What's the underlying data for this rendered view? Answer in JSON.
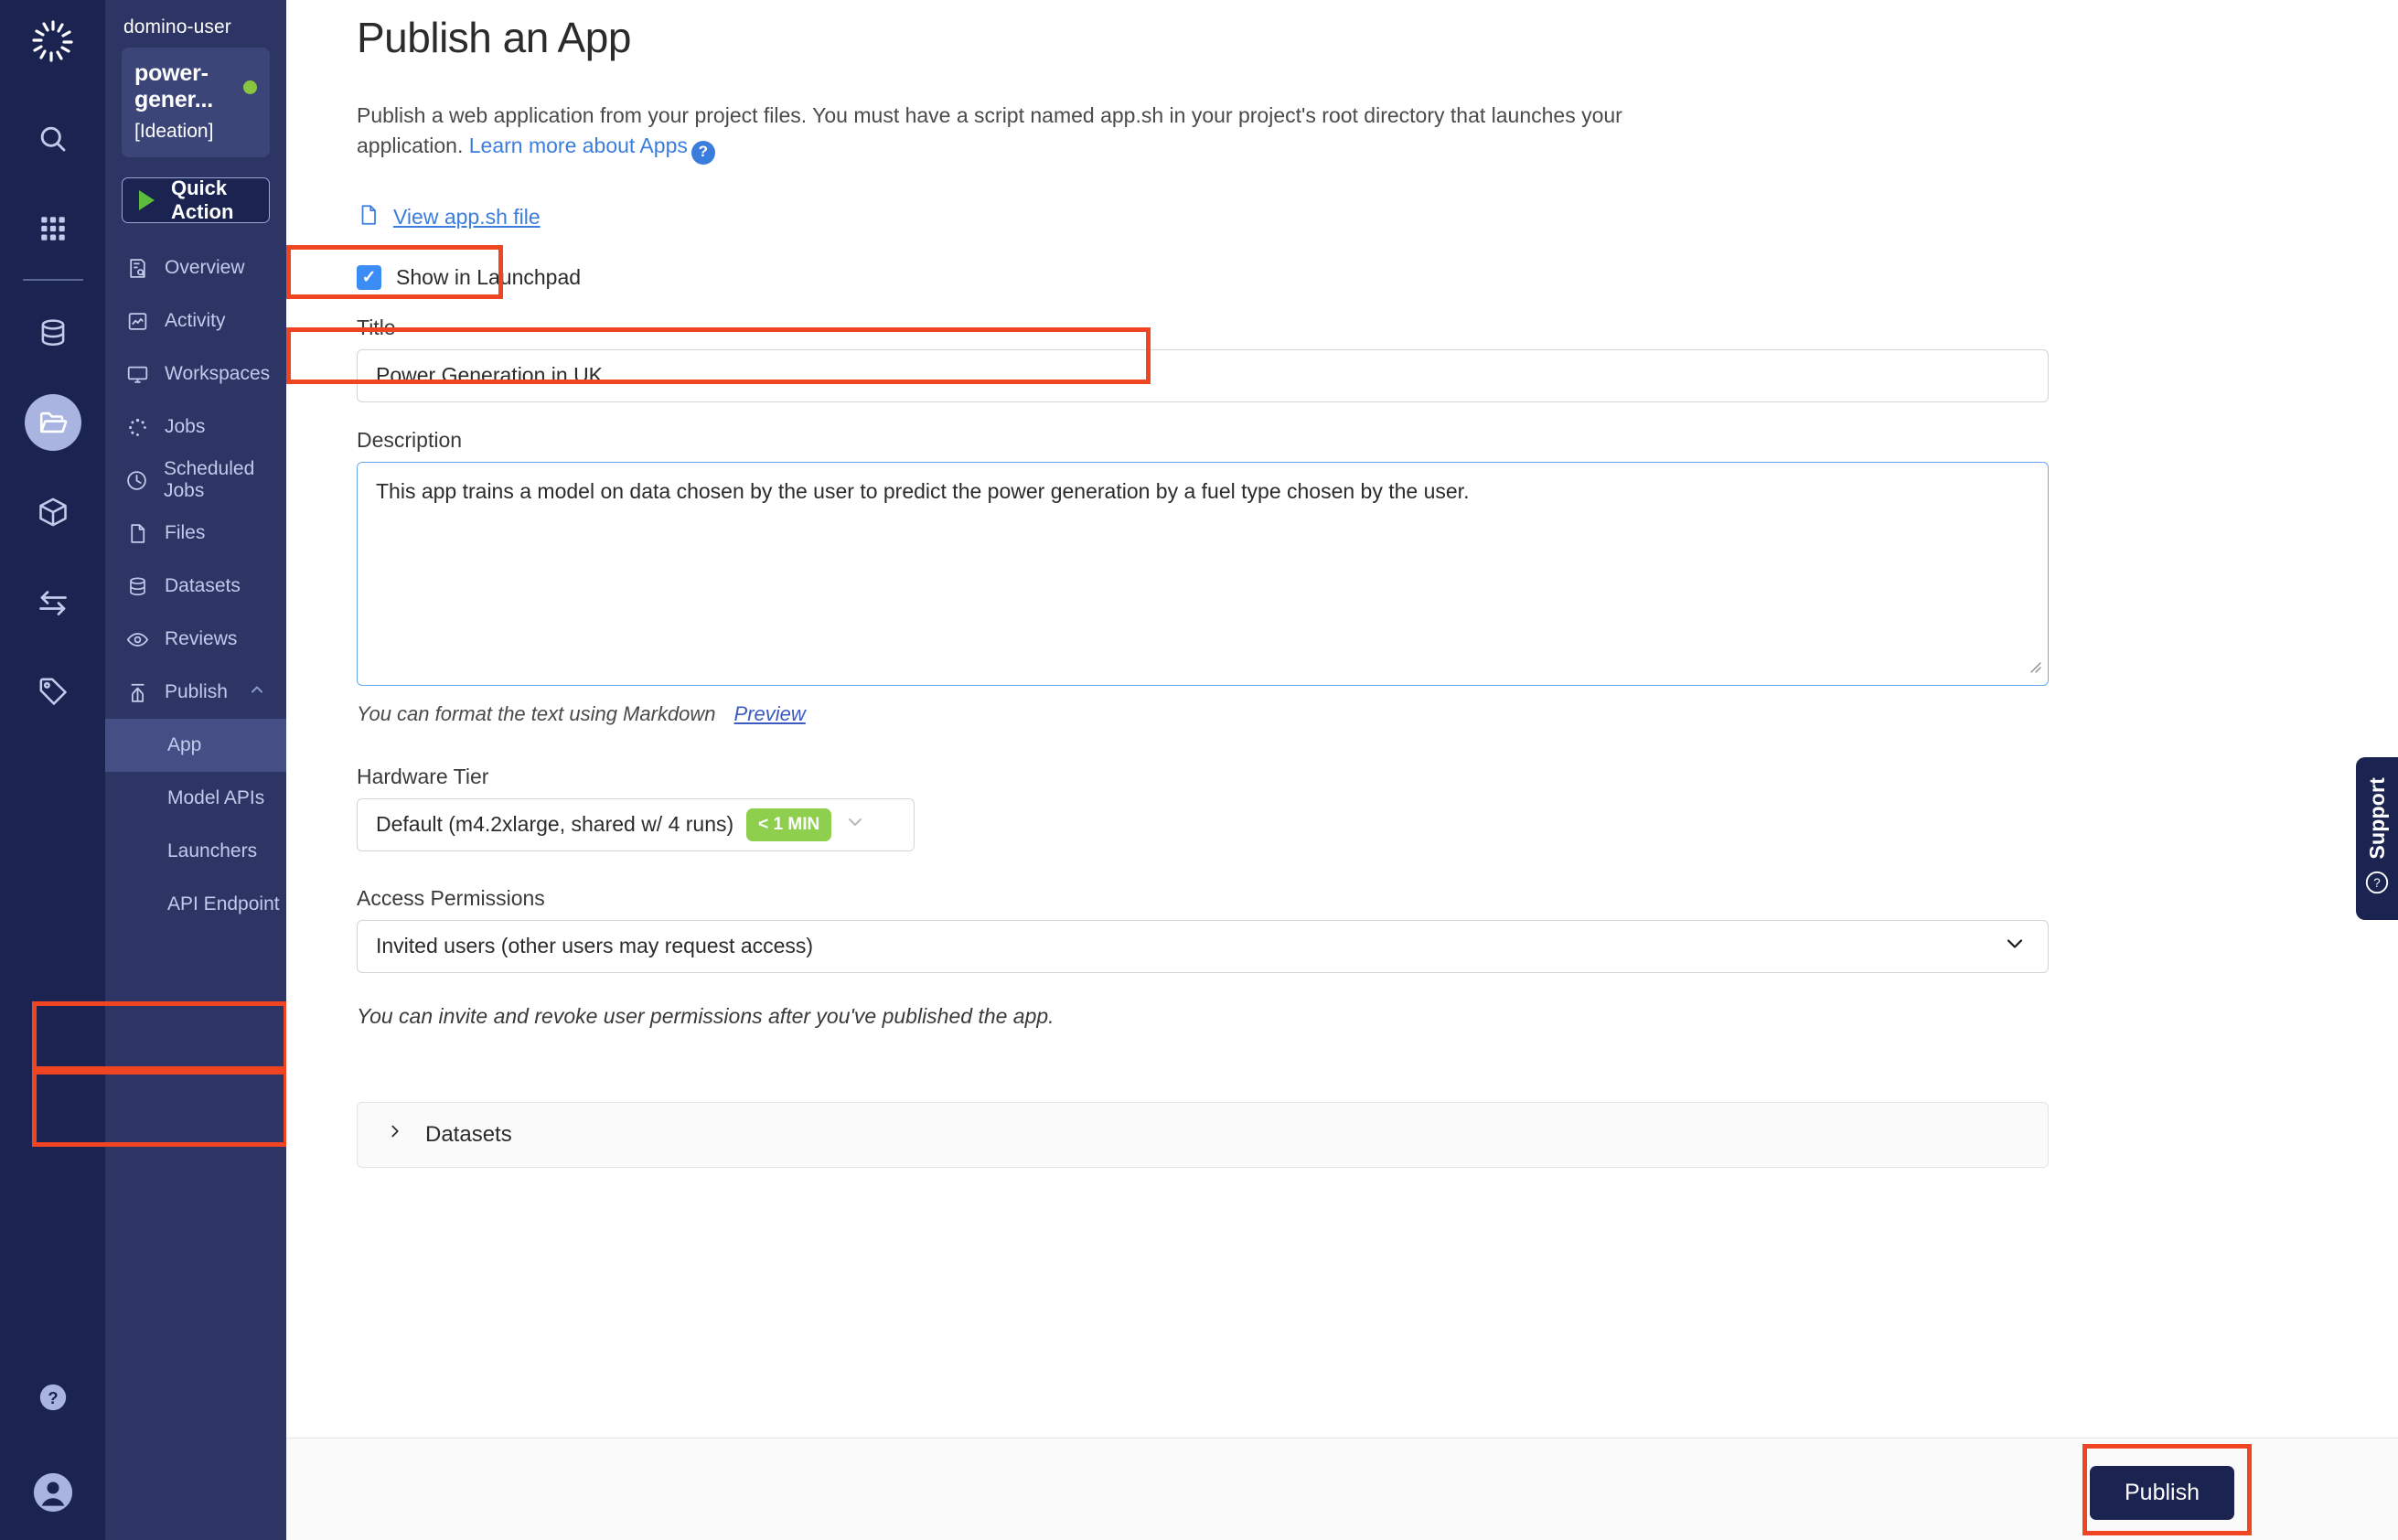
{
  "rail": {
    "icons": [
      {
        "name": "domino-logo-icon",
        "label": "Domino"
      },
      {
        "name": "search-icon",
        "label": "Search"
      },
      {
        "name": "grid-apps-icon",
        "label": "Apps"
      },
      {
        "name": "database-icon",
        "label": "Data"
      },
      {
        "name": "folder-open-icon",
        "label": "Projects"
      },
      {
        "name": "cube-icon",
        "label": "Environments"
      },
      {
        "name": "transfer-arrows-icon",
        "label": "Transfers"
      },
      {
        "name": "tag-icon",
        "label": "Tags"
      }
    ],
    "bottom_icons": [
      {
        "name": "help-circle-icon",
        "label": "Help"
      },
      {
        "name": "user-avatar-icon",
        "label": "Account"
      }
    ]
  },
  "sidebar": {
    "user": "domino-user",
    "project_name": "power-gener...",
    "project_stage": "[Ideation]",
    "status_color": "#89c540",
    "quick_action_label": "Quick Action",
    "items": [
      {
        "label": "Overview",
        "icon": "overview-icon"
      },
      {
        "label": "Activity",
        "icon": "activity-icon"
      },
      {
        "label": "Workspaces",
        "icon": "workspaces-monitor-icon"
      },
      {
        "label": "Jobs",
        "icon": "jobs-spinner-icon"
      },
      {
        "label": "Scheduled Jobs",
        "icon": "clock-icon"
      },
      {
        "label": "Files",
        "icon": "file-icon"
      },
      {
        "label": "Datasets",
        "icon": "database-icon"
      },
      {
        "label": "Reviews",
        "icon": "eye-icon"
      },
      {
        "label": "Publish",
        "icon": "publish-upload-icon",
        "expanded": true,
        "chevron": "chevron-up-icon"
      }
    ],
    "publish_children": [
      {
        "label": "App",
        "active": true
      },
      {
        "label": "Model APIs",
        "active": false
      },
      {
        "label": "Launchers",
        "active": false
      },
      {
        "label": "API Endpoint",
        "active": false
      }
    ]
  },
  "main": {
    "title": "Publish an App",
    "intro_text": "Publish a web application from your project files. You must have a script named app.sh in your project's root directory that launches your application. ",
    "intro_link": "Learn more about Apps",
    "help_glyph": "?",
    "view_file_link": "View app.sh file",
    "show_in_launchpad_label": "Show in Launchpad",
    "show_in_launchpad_checked": true,
    "title_field": {
      "label": "Title",
      "value": "Power Generation in UK"
    },
    "description_field": {
      "label": "Description",
      "value": "This app trains a model on data chosen by the user to predict the power generation by a fuel type chosen by the user."
    },
    "markdown_hint": "You can format the text using Markdown",
    "preview_link": "Preview",
    "hardware_tier": {
      "label": "Hardware Tier",
      "value": "Default (m4.2xlarge, shared w/ 4 runs)",
      "badge": "< 1 MIN",
      "badge_color": "#8ecf4d"
    },
    "access_permissions": {
      "label": "Access Permissions",
      "value": "Invited users (other users may request access)"
    },
    "permissions_note": "You can invite and revoke user permissions after you've published the app.",
    "datasets_accordion": "Datasets",
    "publish_button": "Publish"
  },
  "support": {
    "label": "Support",
    "icon": "help-circle-icon"
  },
  "highlight_color": "#f04522"
}
